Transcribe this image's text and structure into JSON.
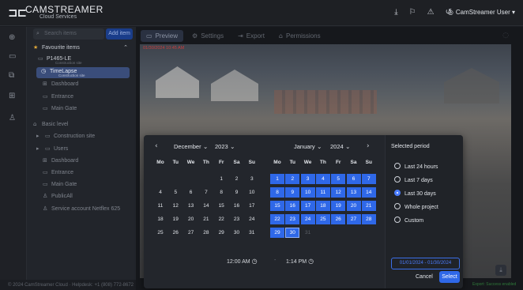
{
  "app": {
    "logo_mark": "⊐⊏",
    "brand": "CAMSTREAMER",
    "brand_sub": "Cloud Services",
    "user": "CamStreamer User"
  },
  "sidebar": {
    "search_placeholder": "Search items",
    "add_item": "Add item",
    "favourite_header": "Favourite items",
    "fav_items": [
      {
        "label": "P1465-LE",
        "sub": "Construction site"
      },
      {
        "label": "TimeLapse",
        "sub": "Construction site"
      },
      {
        "label": "Dashboard"
      },
      {
        "label": "Entrance"
      },
      {
        "label": "Main Gate"
      }
    ],
    "basic_level": "Basic level",
    "tree": [
      "Construction site",
      "Users",
      "Dashboard",
      "Entrance",
      "Main Gate",
      "PublicAll",
      "Service account Netflex 625"
    ],
    "footer": "© 2024 CamStreamer Cloud · Helpdesk: +1 (808) 772-8672"
  },
  "tabs": [
    "Preview",
    "Settings",
    "Export",
    "Permissions"
  ],
  "preview": {
    "timestamp": "01/30/2024 10:45 AM",
    "status_note": "Export: Success enabled"
  },
  "picker": {
    "left": {
      "month": "December",
      "year": "2023",
      "weekdays": [
        "Mo",
        "Tu",
        "We",
        "Th",
        "Fr",
        "Sa",
        "Su"
      ],
      "weeks": [
        [
          "",
          "",
          "",
          "",
          "1",
          "2",
          "3"
        ],
        [
          "4",
          "5",
          "6",
          "7",
          "8",
          "9",
          "10"
        ],
        [
          "11",
          "12",
          "13",
          "14",
          "15",
          "16",
          "17"
        ],
        [
          "18",
          "19",
          "20",
          "21",
          "22",
          "23",
          "24"
        ],
        [
          "25",
          "26",
          "27",
          "28",
          "29",
          "30",
          "31"
        ]
      ]
    },
    "right": {
      "month": "January",
      "year": "2024",
      "weekdays": [
        "Mo",
        "Tu",
        "We",
        "Th",
        "Fr",
        "Sa",
        "Su"
      ],
      "weeks": [
        [
          "1",
          "2",
          "3",
          "4",
          "5",
          "6",
          "7"
        ],
        [
          "8",
          "9",
          "10",
          "11",
          "12",
          "13",
          "14"
        ],
        [
          "15",
          "16",
          "17",
          "18",
          "19",
          "20",
          "21"
        ],
        [
          "22",
          "23",
          "24",
          "25",
          "26",
          "27",
          "28"
        ],
        [
          "29",
          "30",
          "31",
          "",
          "",
          "",
          ""
        ]
      ],
      "selected_through": "30"
    },
    "start_time": "12:00 AM",
    "end_time": "1:14 PM",
    "time_separator": "-",
    "period_header": "Selected period",
    "periods": [
      "Last 24 hours",
      "Last 7 days",
      "Last 30 days",
      "Whole project",
      "Custom"
    ],
    "selected_period": "Last 30 days",
    "range_text": "01/01/2024 - 01/30/2024",
    "cancel": "Cancel",
    "select": "Select",
    "accent_color": "#2f68e8"
  }
}
